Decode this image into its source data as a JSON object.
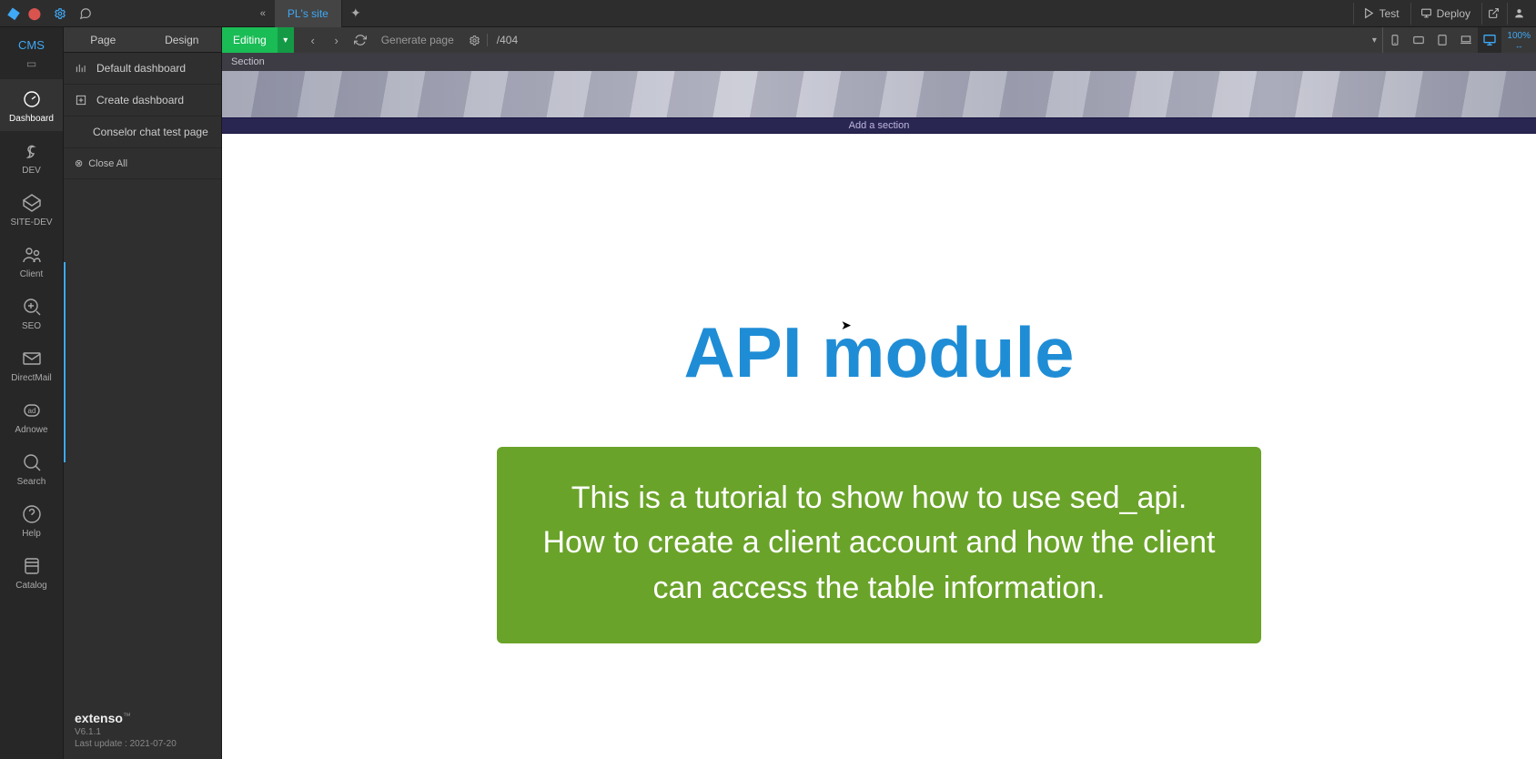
{
  "topbar": {
    "site_tab": "PL's site",
    "test_label": "Test",
    "deploy_label": "Deploy"
  },
  "toolbar": {
    "editing_label": "Editing",
    "generate_page_label": "Generate page",
    "url_path": "/404",
    "zoom_label": "100%"
  },
  "leftrail": {
    "cms_label": "CMS",
    "items": [
      {
        "label": "Dashboard"
      },
      {
        "label": "DEV"
      },
      {
        "label": "SITE-DEV"
      },
      {
        "label": "Client"
      },
      {
        "label": "SEO"
      },
      {
        "label": "DirectMail"
      },
      {
        "label": "Adnowe"
      },
      {
        "label": "Search"
      },
      {
        "label": "Help"
      },
      {
        "label": "Catalog"
      }
    ]
  },
  "sidepanel": {
    "tab_page": "Page",
    "tab_design": "Design",
    "item_default": "Default dashboard",
    "item_create": "Create dashboard",
    "item_conselor": "Conselor chat test page",
    "close_all": "Close All",
    "footer_brand": "extenso",
    "footer_version": "V6.1.1",
    "footer_update": "Last update : 2021-07-20"
  },
  "canvas": {
    "breadcrumb": "Section",
    "add_section": "Add a section",
    "page_title": "API module",
    "green_text": "This is a tutorial to show how to use sed_api. How to create a client account and how the client can access the table information."
  }
}
